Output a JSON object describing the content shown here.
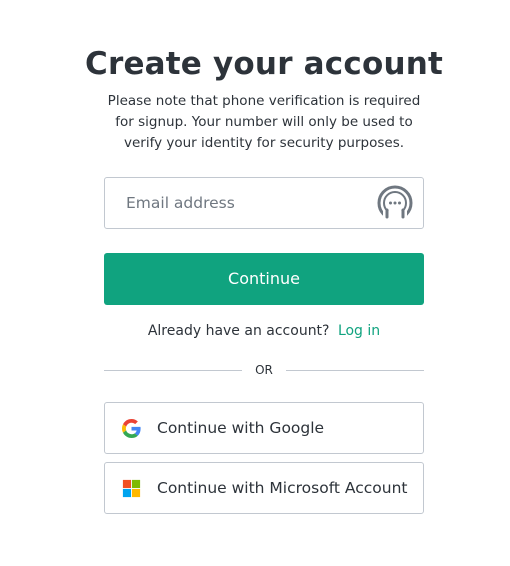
{
  "heading": {
    "title": "Create your account",
    "description": "Please note that phone verification is required for signup. Your number will only be used to verify your identity for security purposes."
  },
  "form": {
    "email_placeholder": "Email address",
    "email_value": "",
    "password_manager_icon": "password-manager-icon",
    "continue_label": "Continue"
  },
  "login": {
    "prompt": "Already have an account?",
    "link_label": "Log in"
  },
  "divider": {
    "label": "OR"
  },
  "social": [
    {
      "label": "Continue with Google",
      "icon": "google-icon"
    },
    {
      "label": "Continue with Microsoft Account",
      "icon": "microsoft-icon"
    }
  ],
  "colors": {
    "accent": "#10a37f",
    "text": "#2d333a",
    "border": "#c2c8d0",
    "placeholder": "#6f7780"
  }
}
